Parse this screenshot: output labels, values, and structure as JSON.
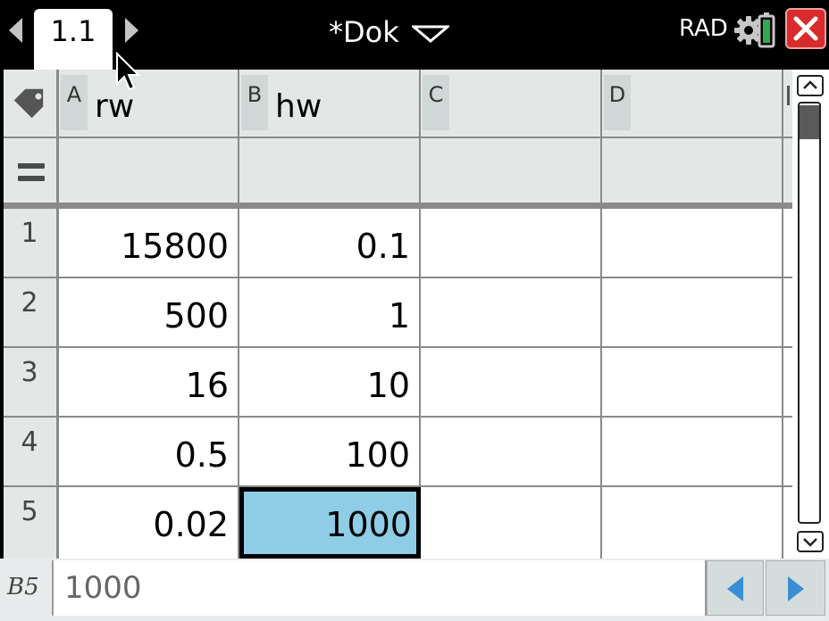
{
  "topbar": {
    "page_tab": "1.1",
    "document_title": "*Dok",
    "angle_mode": "RAD"
  },
  "columns": [
    {
      "letter": "A",
      "name": "rw"
    },
    {
      "letter": "B",
      "name": "hw"
    },
    {
      "letter": "C",
      "name": ""
    },
    {
      "letter": "D",
      "name": ""
    }
  ],
  "rows": [
    {
      "num": "1",
      "A": "15800",
      "B": "0.1",
      "C": "",
      "D": ""
    },
    {
      "num": "2",
      "A": "500",
      "B": "1",
      "C": "",
      "D": ""
    },
    {
      "num": "3",
      "A": "16",
      "B": "10",
      "C": "",
      "D": ""
    },
    {
      "num": "4",
      "A": "0.5",
      "B": "100",
      "C": "",
      "D": ""
    },
    {
      "num": "5",
      "A": "0.02",
      "B": "1000",
      "C": "",
      "D": ""
    }
  ],
  "selection": {
    "cell": "B5"
  },
  "entry": {
    "cell_ref": "B5",
    "value": "1000"
  },
  "colors": {
    "selected_cell": "#8fcde7",
    "header_bg": "#e3e8e7",
    "close_button": "#d92b2b",
    "nav_arrow": "#3a8ed6"
  },
  "icons": [
    "tab-prev-icon",
    "tab-next-icon",
    "dropdown-caret-icon",
    "settings-gear-icon",
    "battery-icon",
    "close-icon",
    "tag-icon",
    "formula-equals-icon",
    "mouse-pointer-icon",
    "scroll-up-icon",
    "scroll-down-icon",
    "nav-left-icon",
    "nav-right-icon"
  ]
}
